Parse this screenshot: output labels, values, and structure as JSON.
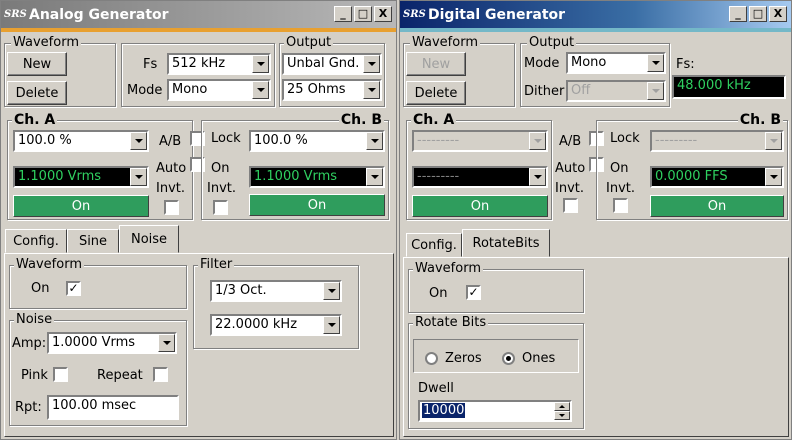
{
  "analog": {
    "title": "Analog Generator",
    "logo": "SRS",
    "window_controls": [
      "_",
      "□",
      "X"
    ],
    "waveform": {
      "label": "Waveform",
      "new_btn": "New",
      "delete_btn": "Delete"
    },
    "fs_label": "Fs",
    "fs_value": "512 kHz",
    "mode_label": "Mode",
    "mode_value": "Mono",
    "output": {
      "label": "Output",
      "type": "Unbal Gnd.",
      "impedance": "25 Ohms"
    },
    "ch_a": {
      "label": "Ch. A",
      "level": "100.0 %",
      "amp": "1.1000 Vrms",
      "on": "On"
    },
    "ch_b": {
      "label": "Ch. B",
      "level": "100.0 %",
      "amp": "1.1000 Vrms",
      "on": "On"
    },
    "ab_label": "A/B",
    "lock_label": "Lock",
    "auto_label": "Auto",
    "on_label": "On",
    "invt_label": "Invt.",
    "tabs": [
      "Config.",
      "Sine",
      "Noise"
    ],
    "active_tab": "Noise",
    "noise_tab": {
      "waveform_label": "Waveform",
      "waveform_on": "On",
      "filter_label": "Filter",
      "filter_type": "1/3 Oct.",
      "filter_freq": "22.0000 kHz",
      "noise_label": "Noise",
      "amp_label": "Amp:",
      "amp_value": "1.0000 Vrms",
      "pink_label": "Pink",
      "repeat_label": "Repeat",
      "rpt_label": "Rpt:",
      "rpt_value": "100.00 msec"
    }
  },
  "digital": {
    "title": "Digital Generator",
    "logo": "SRS",
    "window_controls": [
      "_",
      "□",
      "X"
    ],
    "waveform": {
      "label": "Waveform",
      "new_btn": "New",
      "delete_btn": "Delete"
    },
    "output_label": "Output",
    "mode_label": "Mode",
    "mode_value": "Mono",
    "dither_label": "Dither",
    "dither_value": "Off",
    "fs_label": "Fs:",
    "fs_value": "48.000 kHz",
    "ch_a": {
      "label": "Ch. A",
      "level": "---------",
      "amp": "---------",
      "on": "On"
    },
    "ch_b": {
      "label": "Ch. B",
      "level": "---------",
      "amp": "0.0000 FFS",
      "on": "On"
    },
    "ab_label": "A/B",
    "lock_label": "Lock",
    "auto_label": "Auto",
    "on_label": "On",
    "invt_label": "Invt.",
    "tabs": [
      "Config.",
      "RotateBits"
    ],
    "active_tab": "RotateBits",
    "rotate_tab": {
      "waveform_label": "Waveform",
      "waveform_on": "On",
      "rotate_label": "Rotate Bits",
      "zeros_label": "Zeros",
      "ones_label": "Ones",
      "dwell_label": "Dwell",
      "dwell_value": "10000"
    }
  },
  "colors": {
    "on_button": "#2f9d5d",
    "display_text": "#2fd060",
    "analog_accent": "#e8a030",
    "digital_title": "#0a246a"
  }
}
